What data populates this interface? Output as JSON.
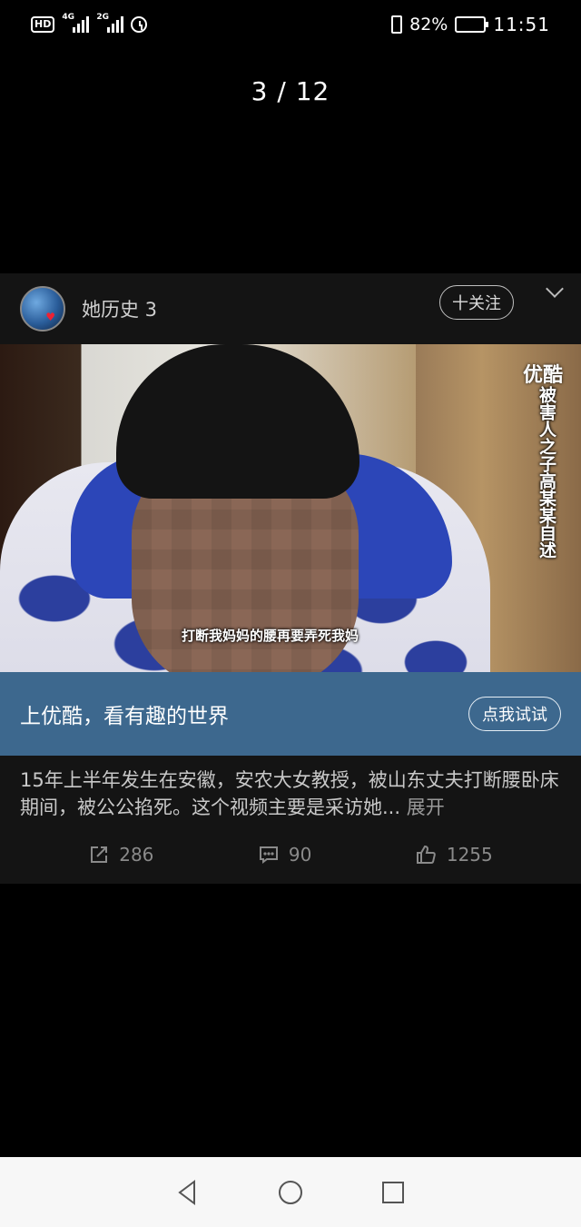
{
  "status_bar": {
    "hd_label": "HD",
    "sig1_gen": "4G",
    "sig2_gen": "2G",
    "battery_percent": "82%",
    "battery_level": 0.82,
    "time": "11:51"
  },
  "viewer": {
    "counter": "3 / 12"
  },
  "post": {
    "author": "她历史 3",
    "follow_label": "十关注",
    "video": {
      "logo": "优酷",
      "vertical_caption": "被害人之子高某某自述",
      "subtitle": "打断我妈妈的腰再要弄死我妈"
    },
    "ad": {
      "text": "上优酷，看有趣的世界",
      "button_label": "点我试试"
    },
    "description": "15年上半年发生在安徽，安农大女教授，被山东丈夫打断腰卧床期间，被公公掐死。这个视频主要是采访她...",
    "expand_label": "展开",
    "stats": {
      "shares": "286",
      "comments": "90",
      "likes": "1255"
    }
  },
  "icons": {
    "share": "share-icon",
    "comment": "comment-icon",
    "like": "like-icon",
    "back": "back-icon",
    "home": "home-icon",
    "recents": "recents-icon"
  }
}
